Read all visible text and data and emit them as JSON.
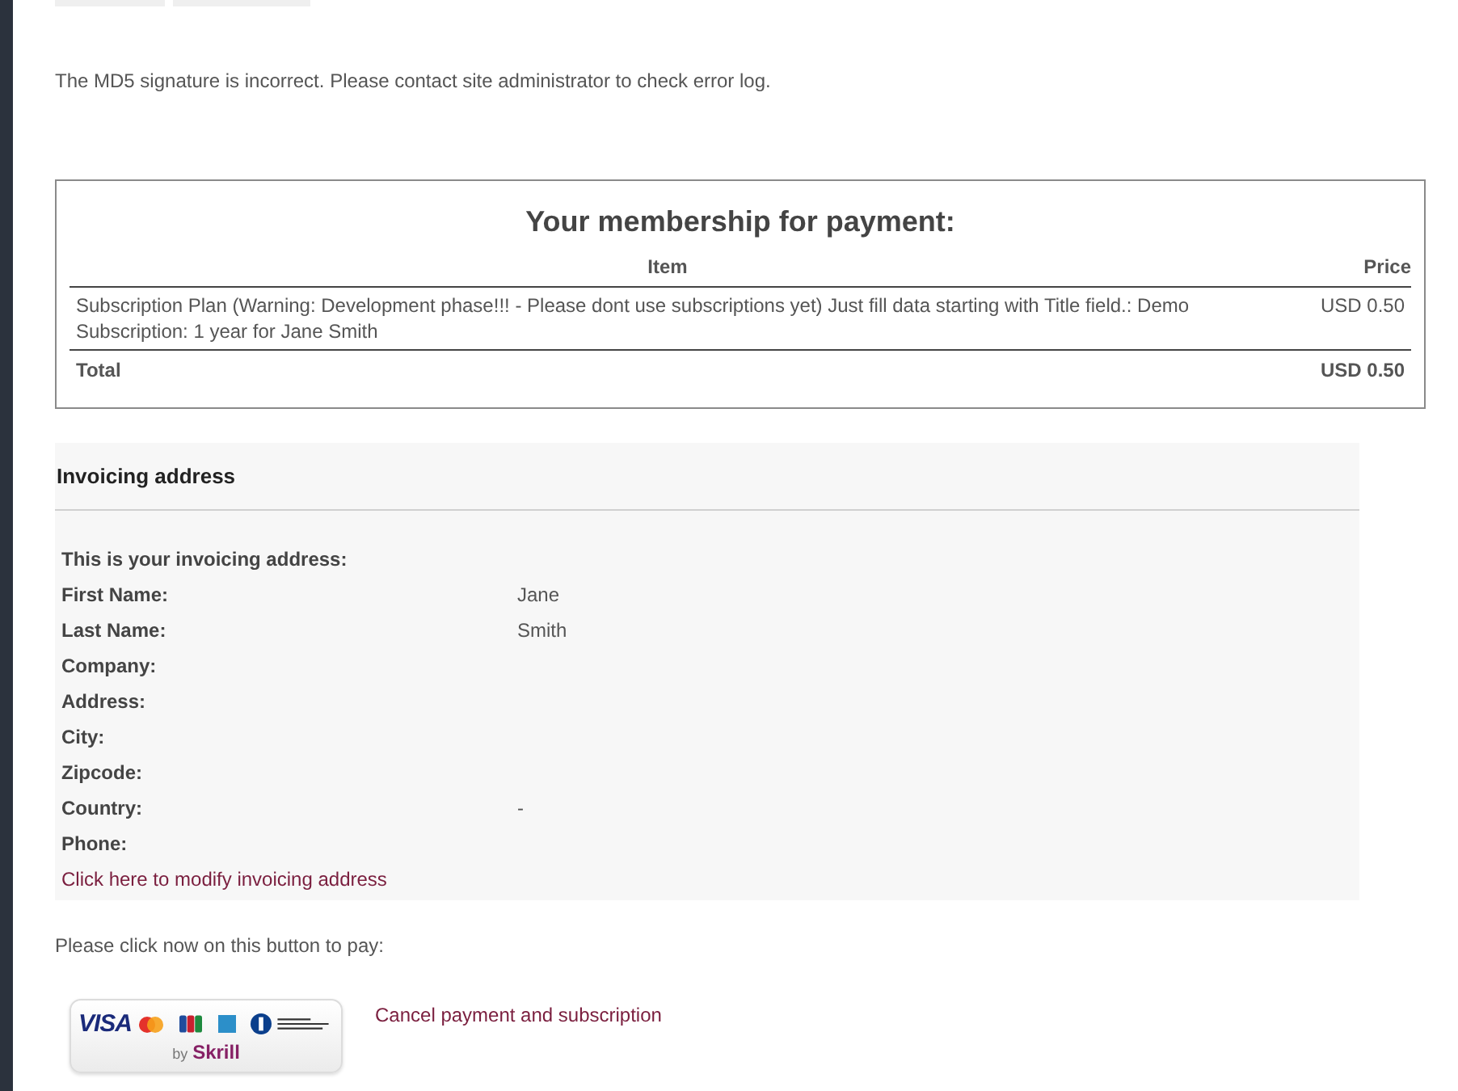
{
  "message": "The MD5 signature is incorrect. Please contact site administrator to check error log.",
  "membership": {
    "title": "Your membership for payment:",
    "columns": [
      "Item",
      "Price"
    ],
    "rows": [
      {
        "item": "Subscription Plan (Warning: Development phase!!! - Please dont use subscriptions yet) Just fill data starting with Title field.: Demo Subscription: 1 year for Jane Smith",
        "price": "USD 0.50"
      }
    ],
    "total": {
      "label": "Total",
      "price": "USD 0.50"
    }
  },
  "invoicing": {
    "heading": "Invoicing address",
    "intro": "This is your invoicing address:",
    "fields": [
      {
        "label": "First Name:",
        "value": "Jane"
      },
      {
        "label": "Last Name:",
        "value": "Smith"
      },
      {
        "label": "Company:"
      },
      {
        "label": "Address:"
      },
      {
        "label": "City:"
      },
      {
        "label": "Zipcode:"
      },
      {
        "label": "Country:",
        "value": "-"
      },
      {
        "label": "Phone:"
      }
    ],
    "modify_link": "Click here to modify invoicing address"
  },
  "pay_prompt": "Please click now on this button to pay:",
  "pay_button": {
    "brand": "VISA",
    "provider_prefix": "by",
    "provider": "Skrill"
  },
  "cancel_link": "Cancel payment and subscription"
}
